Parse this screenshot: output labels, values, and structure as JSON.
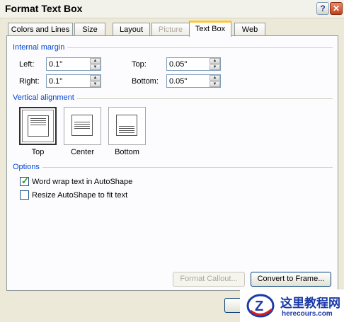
{
  "window": {
    "title": "Format Text Box",
    "help_glyph": "?",
    "close_glyph": "✕"
  },
  "tabs": [
    {
      "label": "Colors and Lines",
      "state": "normal"
    },
    {
      "label": "Size",
      "state": "normal"
    },
    {
      "label": "Layout",
      "state": "normal"
    },
    {
      "label": "Picture",
      "state": "disabled"
    },
    {
      "label": "Text Box",
      "state": "active"
    },
    {
      "label": "Web",
      "state": "normal"
    }
  ],
  "internal_margin": {
    "heading": "Internal margin",
    "left": {
      "label": "Left:",
      "value": "0.1\""
    },
    "right": {
      "label": "Right:",
      "value": "0.1\""
    },
    "top": {
      "label": "Top:",
      "value": "0.05\""
    },
    "bottom": {
      "label": "Bottom:",
      "value": "0.05\""
    }
  },
  "vertical_alignment": {
    "heading": "Vertical alignment",
    "options": [
      {
        "label": "Top",
        "selected": true,
        "icon": "align-top-icon"
      },
      {
        "label": "Center",
        "selected": false,
        "icon": "align-center-icon"
      },
      {
        "label": "Bottom",
        "selected": false,
        "icon": "align-bottom-icon"
      }
    ]
  },
  "options": {
    "heading": "Options",
    "word_wrap": {
      "label": "Word wrap text in AutoShape",
      "checked": true
    },
    "resize": {
      "label": "Resize AutoShape to fit text",
      "checked": false
    }
  },
  "buttons": {
    "format_callout": "Format Callout...",
    "convert_to_frame": "Convert to Frame..."
  },
  "watermark": {
    "line1": "这里教程网",
    "line2": "herecours.com",
    "logo_letter": "Z"
  },
  "colors": {
    "group_heading": "#0046d5",
    "active_tab_accent": "#ffc83c",
    "dialog_bg": "#ece9d8"
  }
}
